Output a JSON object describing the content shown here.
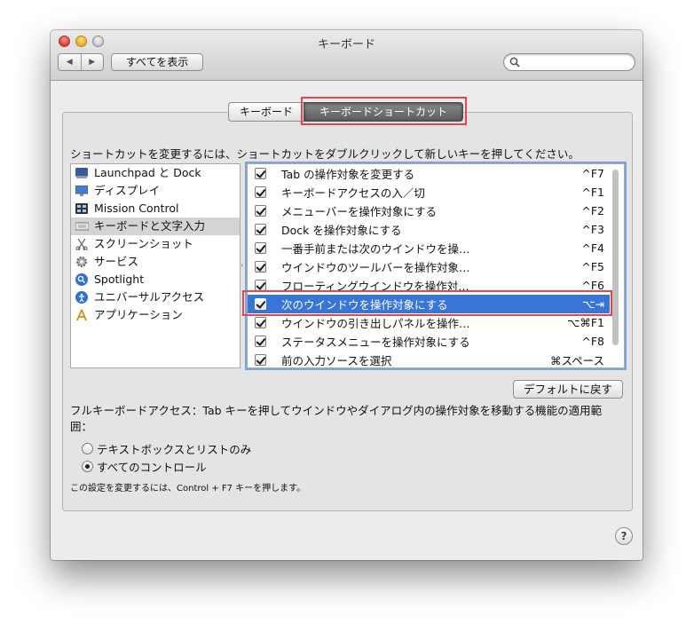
{
  "window": {
    "title": "キーボード"
  },
  "toolbar": {
    "back": "◀",
    "forward": "▶",
    "show_all": "すべてを表示",
    "search_placeholder": ""
  },
  "tabs": [
    {
      "label": "キーボード",
      "selected": false
    },
    {
      "label": "キーボードショートカット",
      "selected": true
    }
  ],
  "instruction": "ショートカットを変更するには、ショートカットをダブルクリックして新しいキーを押してください。",
  "categories": [
    {
      "label": "Launchpad と Dock",
      "icon": "launchpad-icon",
      "selected": false
    },
    {
      "label": "ディスプレイ",
      "icon": "display-icon",
      "selected": false
    },
    {
      "label": "Mission Control",
      "icon": "mission-control-icon",
      "selected": false
    },
    {
      "label": "キーボードと文字入力",
      "icon": "keyboard-icon",
      "selected": true
    },
    {
      "label": "スクリーンショット",
      "icon": "screenshot-icon",
      "selected": false
    },
    {
      "label": "サービス",
      "icon": "gear-icon",
      "selected": false
    },
    {
      "label": "Spotlight",
      "icon": "spotlight-icon",
      "selected": false
    },
    {
      "label": "ユニバーサルアクセス",
      "icon": "accessibility-icon",
      "selected": false
    },
    {
      "label": "アプリケーション",
      "icon": "app-store-icon",
      "selected": false
    }
  ],
  "shortcuts": [
    {
      "action": "Tab の操作対象を変更する",
      "key": "^F7",
      "checked": true,
      "selected": false
    },
    {
      "action": "キーボードアクセスの入／切",
      "key": "^F1",
      "checked": true,
      "selected": false
    },
    {
      "action": "メニューバーを操作対象にする",
      "key": "^F2",
      "checked": true,
      "selected": false
    },
    {
      "action": "Dock を操作対象にする",
      "key": "^F3",
      "checked": true,
      "selected": false
    },
    {
      "action": "一番手前または次のウインドウを操…",
      "key": "^F4",
      "checked": true,
      "selected": false
    },
    {
      "action": "ウインドウのツールバーを操作対象…",
      "key": "^F5",
      "checked": true,
      "selected": false
    },
    {
      "action": "フローティングウインドウを操作対…",
      "key": "^F6",
      "checked": true,
      "selected": false
    },
    {
      "action": "次のウインドウを操作対象にする",
      "key": "⌥⇥",
      "checked": true,
      "selected": true
    },
    {
      "action": "ウインドウの引き出しパネルを操作…",
      "key": "⌥⌘F1",
      "checked": true,
      "selected": false
    },
    {
      "action": "ステータスメニューを操作対象にする",
      "key": "^F8",
      "checked": true,
      "selected": false
    },
    {
      "action": "前の入力ソースを選択",
      "key": "⌘スペース",
      "checked": true,
      "selected": false
    }
  ],
  "default_button": "デフォルトに戻す",
  "full_keyboard_access": "フルキーボードアクセス：Tab キーを押してウインドウやダイアログ内の操作対象を移動する機能の適用範囲：",
  "radio_options": [
    {
      "label": "テキストボックスとリストのみ",
      "selected": false
    },
    {
      "label": "すべてのコントロール",
      "selected": true
    }
  ],
  "note": "この設定を変更するには、Control + F7 キーを押します。",
  "help": "?",
  "colors": {
    "selection": "#3875d7",
    "highlight_box": "#e3464b"
  }
}
